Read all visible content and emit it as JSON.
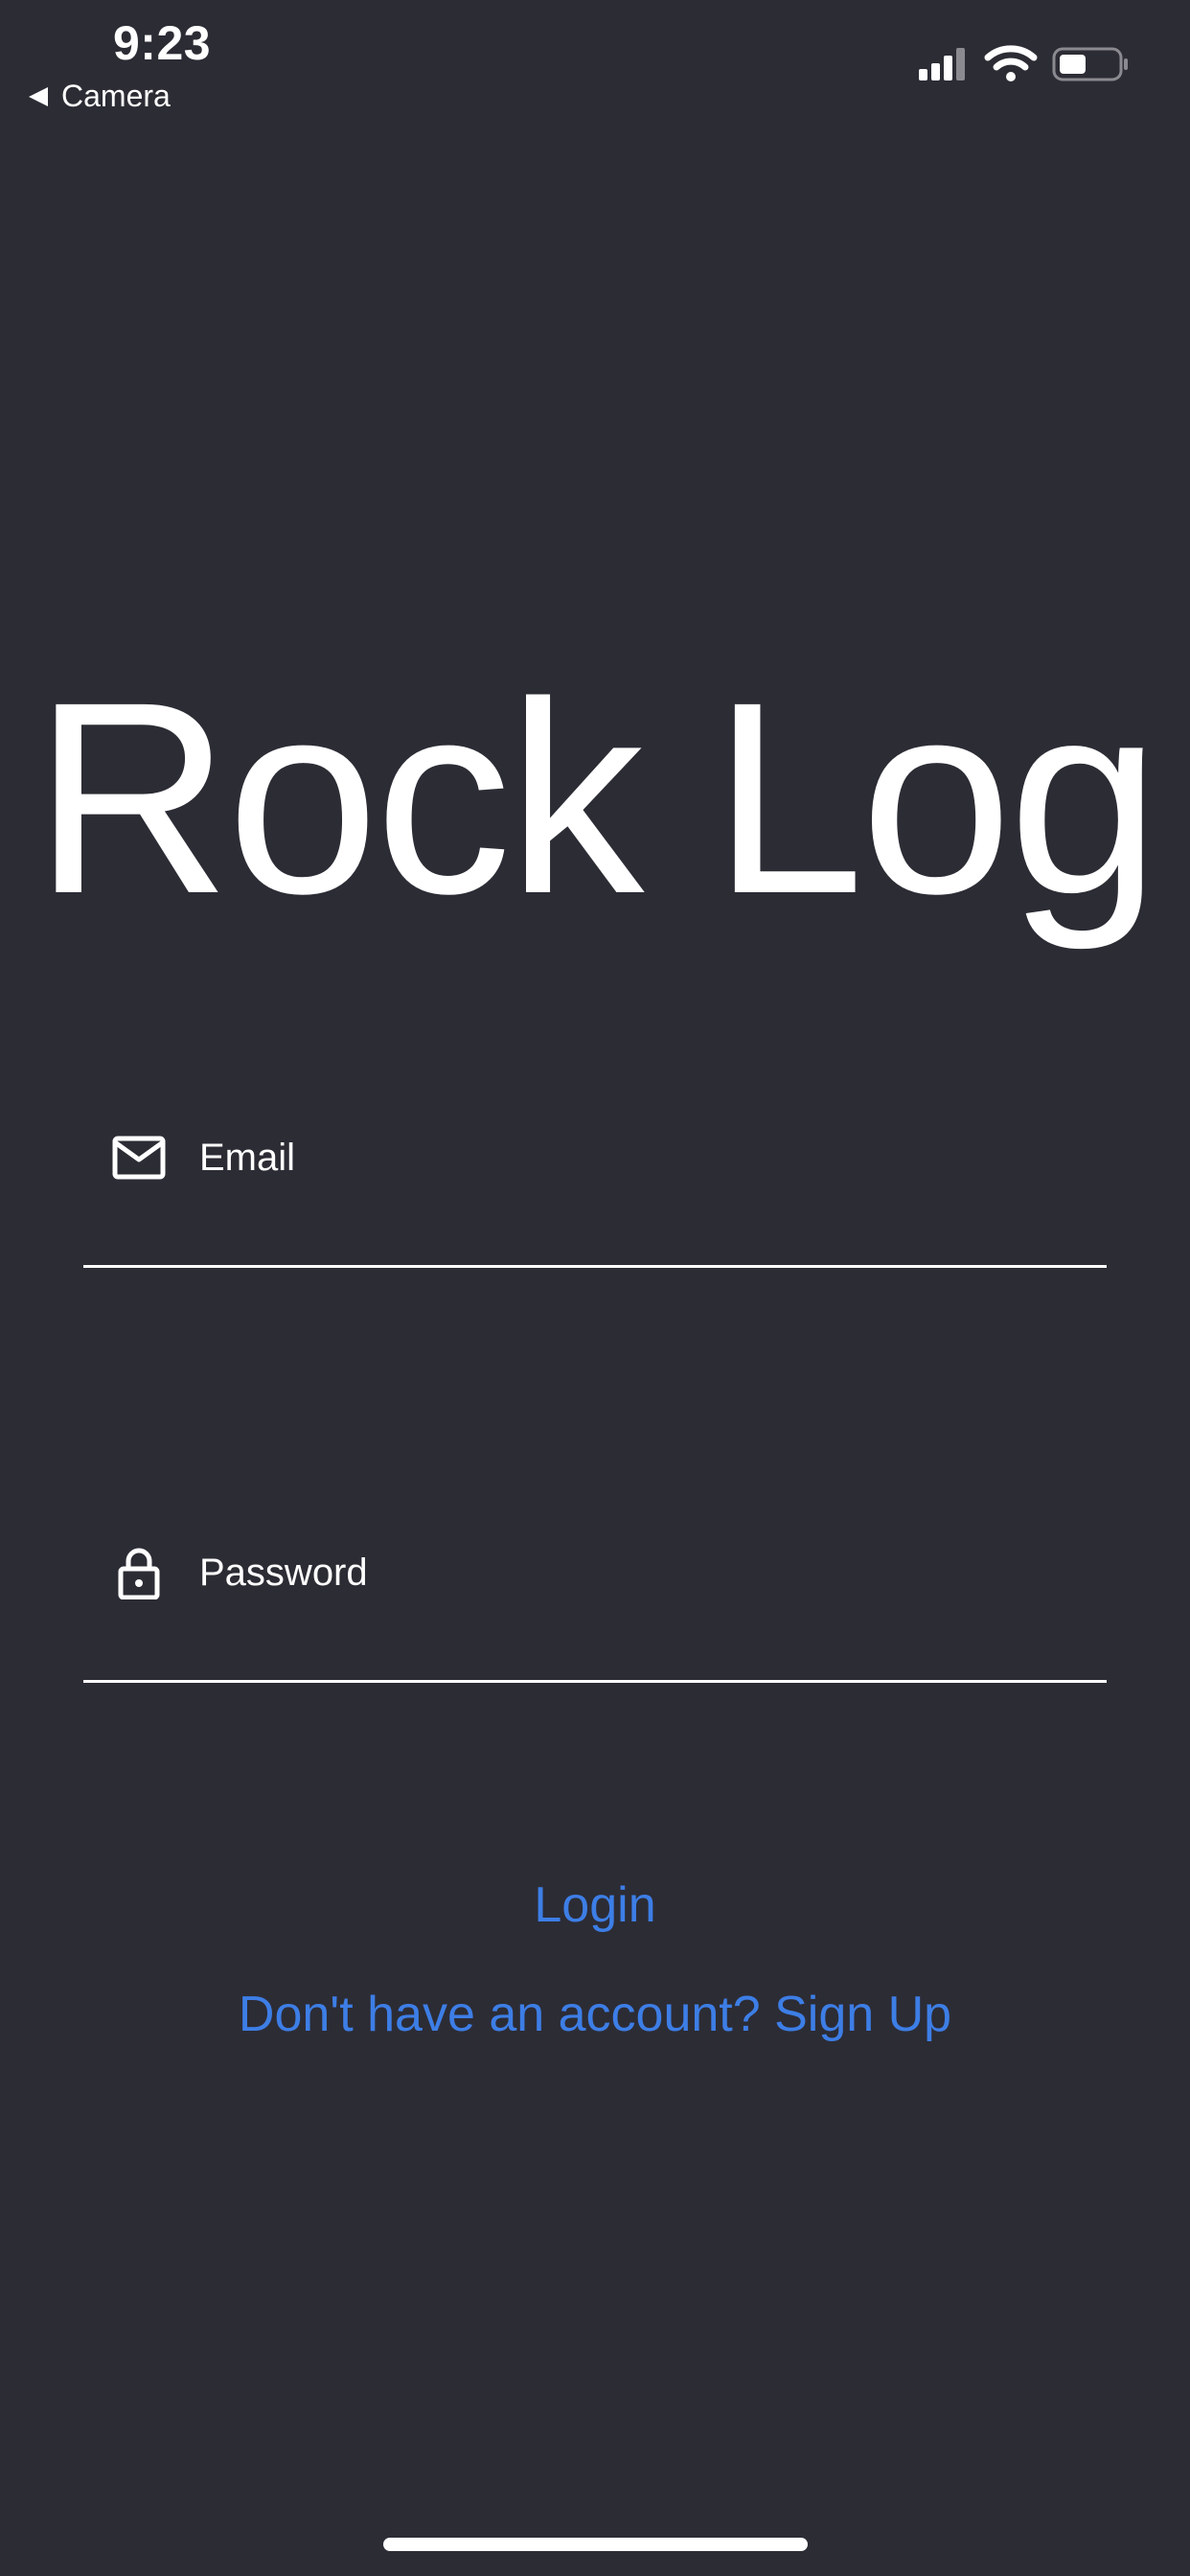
{
  "status_bar": {
    "time": "9:23",
    "back_label": "Camera",
    "icons": [
      "cellular-signal-icon",
      "wifi-icon",
      "battery-icon"
    ]
  },
  "app": {
    "title": "Rock Log"
  },
  "form": {
    "email": {
      "icon": "mail-icon",
      "placeholder": "Email",
      "value": ""
    },
    "password": {
      "icon": "lock-icon",
      "placeholder": "Password",
      "value": ""
    }
  },
  "actions": {
    "login_label": "Login",
    "signup_label": "Don't have an account? Sign Up"
  },
  "colors": {
    "background": "#2c2c35",
    "text": "#ffffff",
    "accent": "#3d7ee6"
  }
}
